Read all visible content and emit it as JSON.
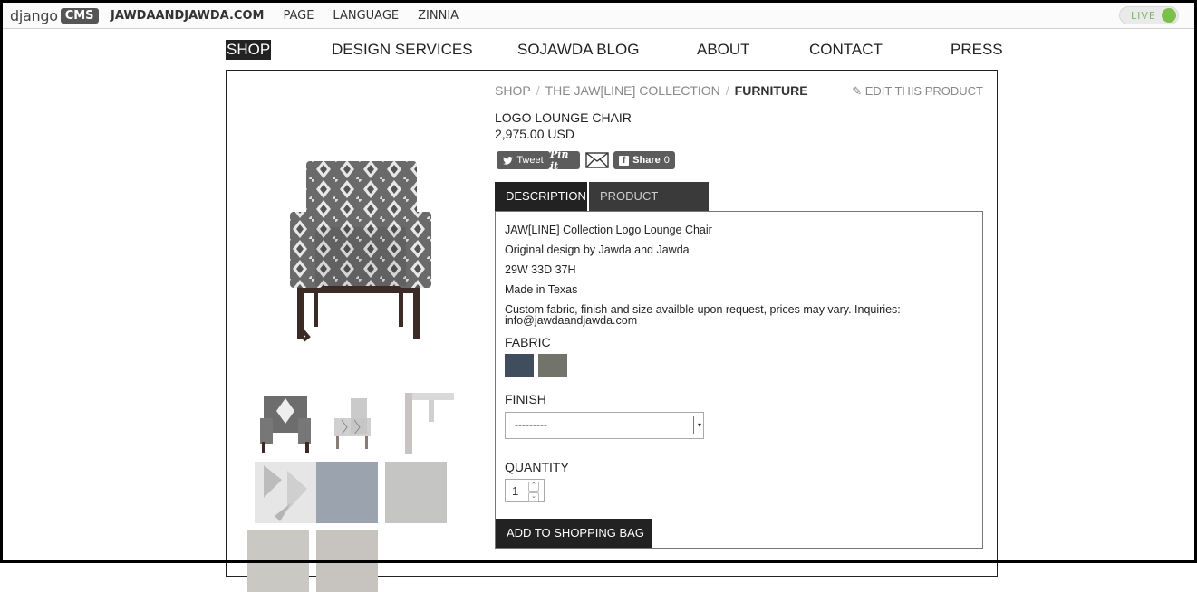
{
  "cms_toolbar": {
    "logo_text": "django",
    "logo_badge": "CMS",
    "site_name": "JAWDAANDJAWDA.COM",
    "menu": [
      "PAGE",
      "LANGUAGE",
      "ZINNIA"
    ],
    "live_label": "LIVE"
  },
  "nav": {
    "items": [
      "SHOP",
      "DESIGN SERVICES",
      "SOJAWDA BLOG",
      "ABOUT",
      "CONTACT",
      "PRESS"
    ]
  },
  "breadcrumb": {
    "items": [
      "SHOP",
      "THE JAW[LINE] COLLECTION",
      "FURNITURE"
    ],
    "separator": "/"
  },
  "edit_link": "EDIT THIS PRODUCT",
  "product": {
    "title": "LOGO LOUNGE CHAIR",
    "price": "2,975.00 USD"
  },
  "share": {
    "tweet": "Tweet",
    "pin": "Pin it",
    "share": "Share",
    "share_count": "0"
  },
  "tabs": [
    "DESCRIPTION",
    "PRODUCT DETAILS"
  ],
  "description": [
    "JAW[LINE] Collection Logo Lounge Chair",
    "Original design by Jawda and Jawda",
    "29W 33D 37H",
    "Made in Texas",
    "Custom fabric, finish and size availble upon request, prices may vary. Inquiries:",
    "info@jawdaandjawda.com"
  ],
  "fabric": {
    "label": "FABRIC",
    "swatches": [
      "#3f4d5c",
      "#72736a"
    ]
  },
  "finish": {
    "label": "FINISH",
    "selected": "---------"
  },
  "quantity": {
    "label": "QUANTITY",
    "value": "1"
  },
  "add_to_bag": "ADD TO SHOPPING BAG",
  "colors": {
    "live_dot": "#7cc04b",
    "dark": "#222222"
  }
}
